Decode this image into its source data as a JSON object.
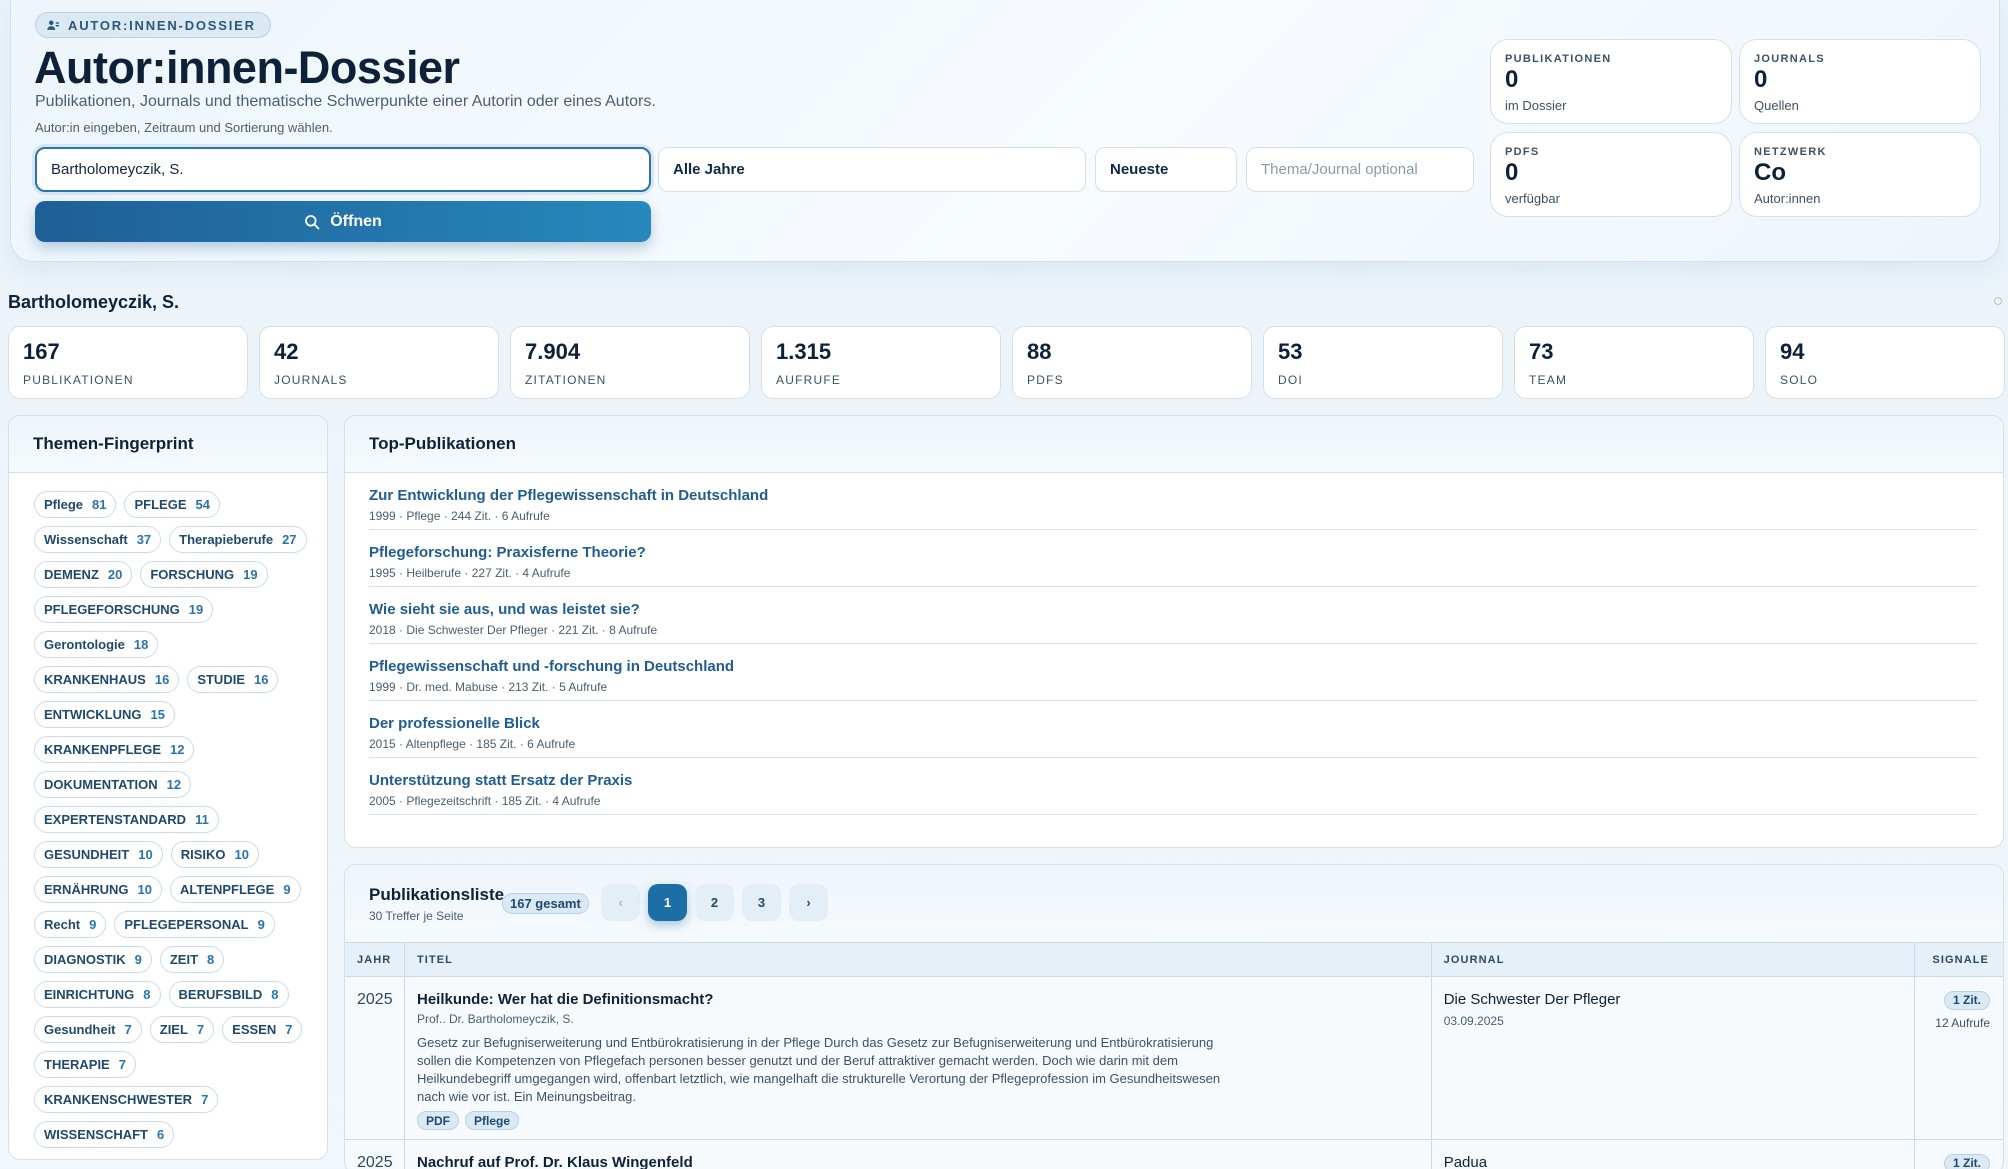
{
  "hero": {
    "eyebrow": "AUTOR:INNEN-DOSSIER",
    "eyebrow_icon": "person-badge-icon",
    "title": "Autor:innen-Dossier",
    "subtitle": "Publikationen, Journals und thematische Schwerpunkte einer Autorin oder eines Autors.",
    "hint": "Autor:in eingeben, Zeitraum und Sortierung wählen.",
    "author_value": "Bartholomeyczik, S.",
    "years_value": "Alle Jahre",
    "sort_value": "Neueste",
    "topic_placeholder": "Thema/Journal optional",
    "open_label": "Öffnen",
    "open_icon": "search-icon"
  },
  "kpis": [
    {
      "label": "PUBLIKATIONEN",
      "value": "0",
      "sub": "im Dossier"
    },
    {
      "label": "JOURNALS",
      "value": "0",
      "sub": "Quellen"
    },
    {
      "label": "PDFS",
      "value": "0",
      "sub": "verfügbar"
    },
    {
      "label": "NETZWERK",
      "value": "Co",
      "sub": "Autor:innen"
    }
  ],
  "author": {
    "name": "Bartholomeyczik, S."
  },
  "stats": [
    {
      "value": "167",
      "label": "PUBLIKATIONEN"
    },
    {
      "value": "42",
      "label": "JOURNALS"
    },
    {
      "value": "7.904",
      "label": "ZITATIONEN"
    },
    {
      "value": "1.315",
      "label": "AUFRUFE"
    },
    {
      "value": "88",
      "label": "PDFS"
    },
    {
      "value": "53",
      "label": "DOI"
    },
    {
      "value": "73",
      "label": "TEAM"
    },
    {
      "value": "94",
      "label": "SOLO"
    }
  ],
  "themes": {
    "title": "Themen-Fingerprint",
    "chips": [
      {
        "label": "Pflege",
        "count": "81"
      },
      {
        "label": "PFLEGE",
        "count": "54"
      },
      {
        "label": "Wissenschaft",
        "count": "37"
      },
      {
        "label": "Therapieberufe",
        "count": "27"
      },
      {
        "label": "DEMENZ",
        "count": "20"
      },
      {
        "label": "FORSCHUNG",
        "count": "19"
      },
      {
        "label": "PFLEGEFORSCHUNG",
        "count": "19"
      },
      {
        "label": "Gerontologie",
        "count": "18"
      },
      {
        "label": "KRANKENHAUS",
        "count": "16"
      },
      {
        "label": "STUDIE",
        "count": "16"
      },
      {
        "label": "ENTWICKLUNG",
        "count": "15"
      },
      {
        "label": "KRANKENPFLEGE",
        "count": "12"
      },
      {
        "label": "DOKUMENTATION",
        "count": "12"
      },
      {
        "label": "EXPERTENSTANDARD",
        "count": "11"
      },
      {
        "label": "GESUNDHEIT",
        "count": "10"
      },
      {
        "label": "RISIKO",
        "count": "10"
      },
      {
        "label": "ERNÄHRUNG",
        "count": "10"
      },
      {
        "label": "ALTENPFLEGE",
        "count": "9"
      },
      {
        "label": "Recht",
        "count": "9"
      },
      {
        "label": "PFLEGEPERSONAL",
        "count": "9"
      },
      {
        "label": "DIAGNOSTIK",
        "count": "9"
      },
      {
        "label": "ZEIT",
        "count": "8"
      },
      {
        "label": "EINRICHTUNG",
        "count": "8"
      },
      {
        "label": "BERUFSBILD",
        "count": "8"
      },
      {
        "label": "Gesundheit",
        "count": "7"
      },
      {
        "label": "ZIEL",
        "count": "7"
      },
      {
        "label": "ESSEN",
        "count": "7"
      },
      {
        "label": "THERAPIE",
        "count": "7"
      },
      {
        "label": "KRANKENSCHWESTER",
        "count": "7"
      },
      {
        "label": "WISSENSCHAFT",
        "count": "6"
      }
    ]
  },
  "top": {
    "title": "Top-Publikationen",
    "items": [
      {
        "title": "Zur Entwicklung der Pflegewissenschaft in Deutschland",
        "meta": "1999 · Pflege · 244 Zit. · 6 Aufrufe"
      },
      {
        "title": "Pflegeforschung: Praxisferne Theorie?",
        "meta": "1995 · Heilberufe · 227 Zit. · 4 Aufrufe"
      },
      {
        "title": "Wie sieht sie aus, und was leistet sie?",
        "meta": "2018 · Die Schwester Der Pfleger · 221 Zit. · 8 Aufrufe"
      },
      {
        "title": "Pflegewissenschaft und -forschung in Deutschland",
        "meta": "1999 · Dr. med. Mabuse · 213 Zit. · 5 Aufrufe"
      },
      {
        "title": "Der professionelle Blick",
        "meta": "2015 · Altenpflege · 185 Zit. · 6 Aufrufe"
      },
      {
        "title": "Unterstützung statt Ersatz der Praxis",
        "meta": "2005 · Pflegezeitschrift · 185 Zit. · 4 Aufrufe"
      }
    ]
  },
  "list": {
    "title": "Publikationsliste",
    "subtitle": "30 Treffer je Seite",
    "total": "167 gesamt",
    "pager": {
      "prev": "‹",
      "pages": [
        "1",
        "2",
        "3"
      ],
      "active": "1",
      "next": "›"
    },
    "columns": {
      "year": "JAHR",
      "title": "TITEL",
      "journal": "JOURNAL",
      "signals": "SIGNALE"
    },
    "rows": [
      {
        "year": "2025",
        "title": "Heilkunde: Wer hat die Definitionsmacht?",
        "authors": "Prof.. Dr. Bartholomeyczik, S.",
        "abstract": "Gesetz zur Befugniserweiterung und Entbürokratisierung in der Pflege Durch das Gesetz zur Befugniserweiterung und Entbürokratisierung sollen die Kompetenzen von Pflegefach personen besser genutzt und der Beruf attraktiver gemacht werden. Doch wie darin mit dem Heilkundebegriff umgegangen wird, offenbart letztlich, wie mangelhaft die strukturelle Verortung der Pflegeprofession im Gesundheitswesen nach wie vor ist. Ein Meinungsbeitrag.",
        "tags": [
          "PDF",
          "Pflege"
        ],
        "journal": "Die Schwester Der Pfleger",
        "date": "03.09.2025",
        "citations": "1 Zit.",
        "views": "12 Aufrufe"
      },
      {
        "year": "2025",
        "title": "Nachruf auf Prof. Dr. Klaus Wingenfeld",
        "journal": "Padua",
        "citations": "1 Zit."
      }
    ]
  }
}
